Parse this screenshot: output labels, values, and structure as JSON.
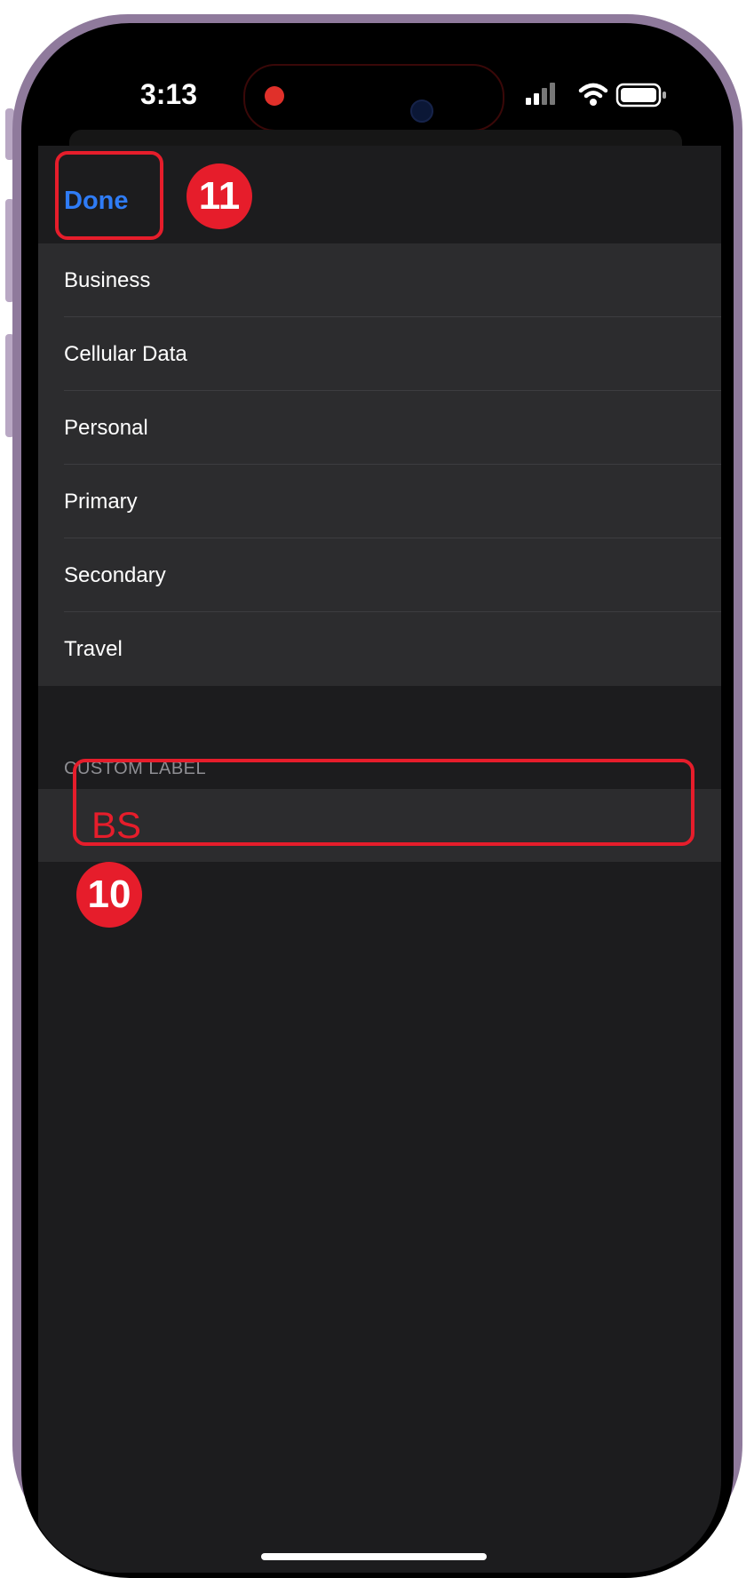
{
  "status_bar": {
    "time": "3:13"
  },
  "nav": {
    "done_label": "Done"
  },
  "label_options": [
    {
      "label": "Business"
    },
    {
      "label": "Cellular Data"
    },
    {
      "label": "Personal"
    },
    {
      "label": "Primary"
    },
    {
      "label": "Secondary"
    },
    {
      "label": "Travel"
    }
  ],
  "custom_label": {
    "section_title": "CUSTOM LABEL",
    "value": "BS"
  },
  "annotations": {
    "step_done": "11",
    "step_custom": "10"
  },
  "colors": {
    "accent_blue": "#2f7cf6",
    "annotation_red": "#e61d2b",
    "cell_background": "#2c2c2e",
    "sheet_background": "#1c1c1e"
  },
  "icons": [
    "signal-icon",
    "wifi-icon",
    "battery-icon"
  ]
}
